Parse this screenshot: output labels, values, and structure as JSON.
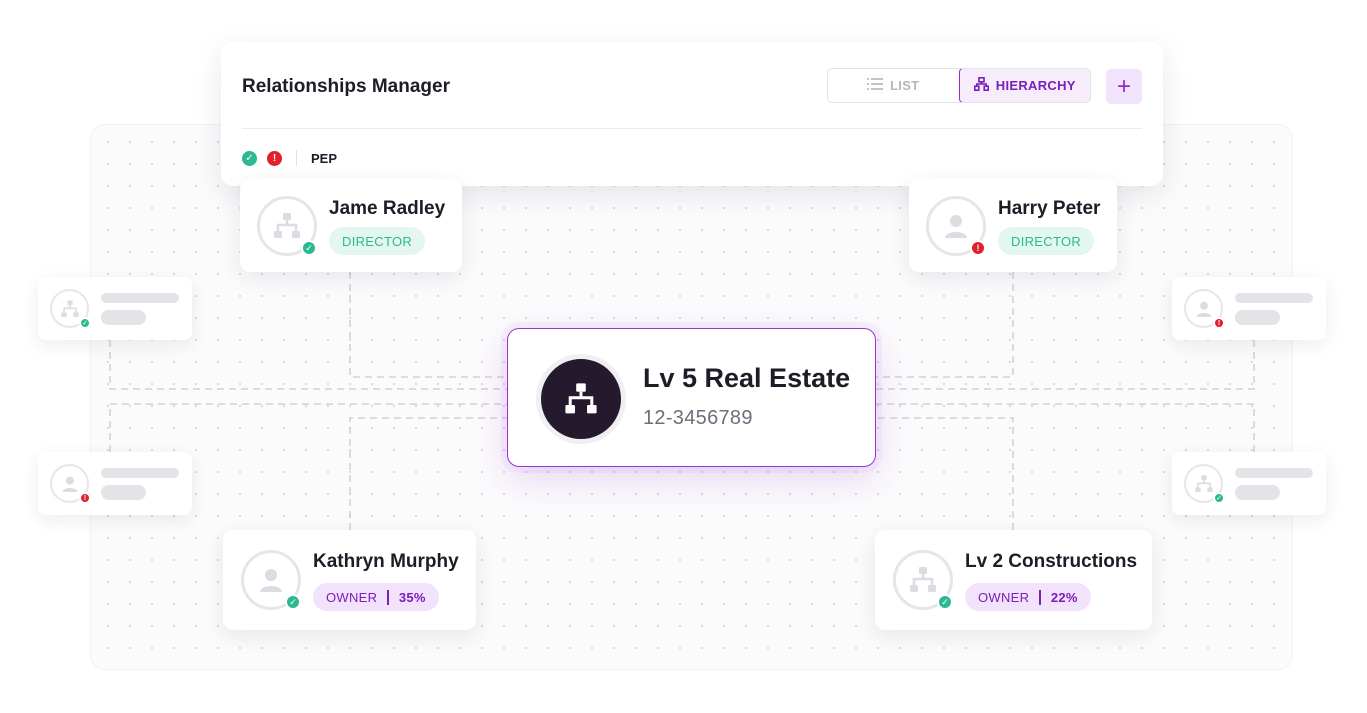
{
  "header": {
    "title": "Relationships Manager",
    "view_toggle": {
      "list_label": "LIST",
      "hierarchy_label": "HIERARCHY",
      "active": "HIERARCHY"
    },
    "add_button": "+",
    "legend": {
      "pep_label": "PEP"
    }
  },
  "center_entity": {
    "name": "Lv 5 Real Estate",
    "id": "12-3456789",
    "icon": "hierarchy-icon"
  },
  "relations": [
    {
      "name": "Jame Radley",
      "role": "DIRECTOR",
      "status": "verified",
      "icon": "org-icon"
    },
    {
      "name": "Harry Peter",
      "role": "DIRECTOR",
      "status": "alert",
      "icon": "user-icon"
    },
    {
      "name": "Kathryn Murphy",
      "role": "OWNER",
      "share": "35%",
      "status": "verified",
      "icon": "user-icon"
    },
    {
      "name": "Lv 2 Constructions",
      "role": "OWNER",
      "share": "22%",
      "status": "verified",
      "icon": "org-icon"
    }
  ],
  "placeholders": [
    {
      "side": "left",
      "status": "verified",
      "icon": "org-icon"
    },
    {
      "side": "right",
      "status": "alert",
      "icon": "user-icon"
    },
    {
      "side": "left",
      "status": "alert",
      "icon": "user-icon"
    },
    {
      "side": "right",
      "status": "verified",
      "icon": "org-icon"
    }
  ],
  "colors": {
    "accent": "#9330cf",
    "verified": "#2db893",
    "alert": "#e0202a",
    "center_icon_bg": "#25192e"
  }
}
